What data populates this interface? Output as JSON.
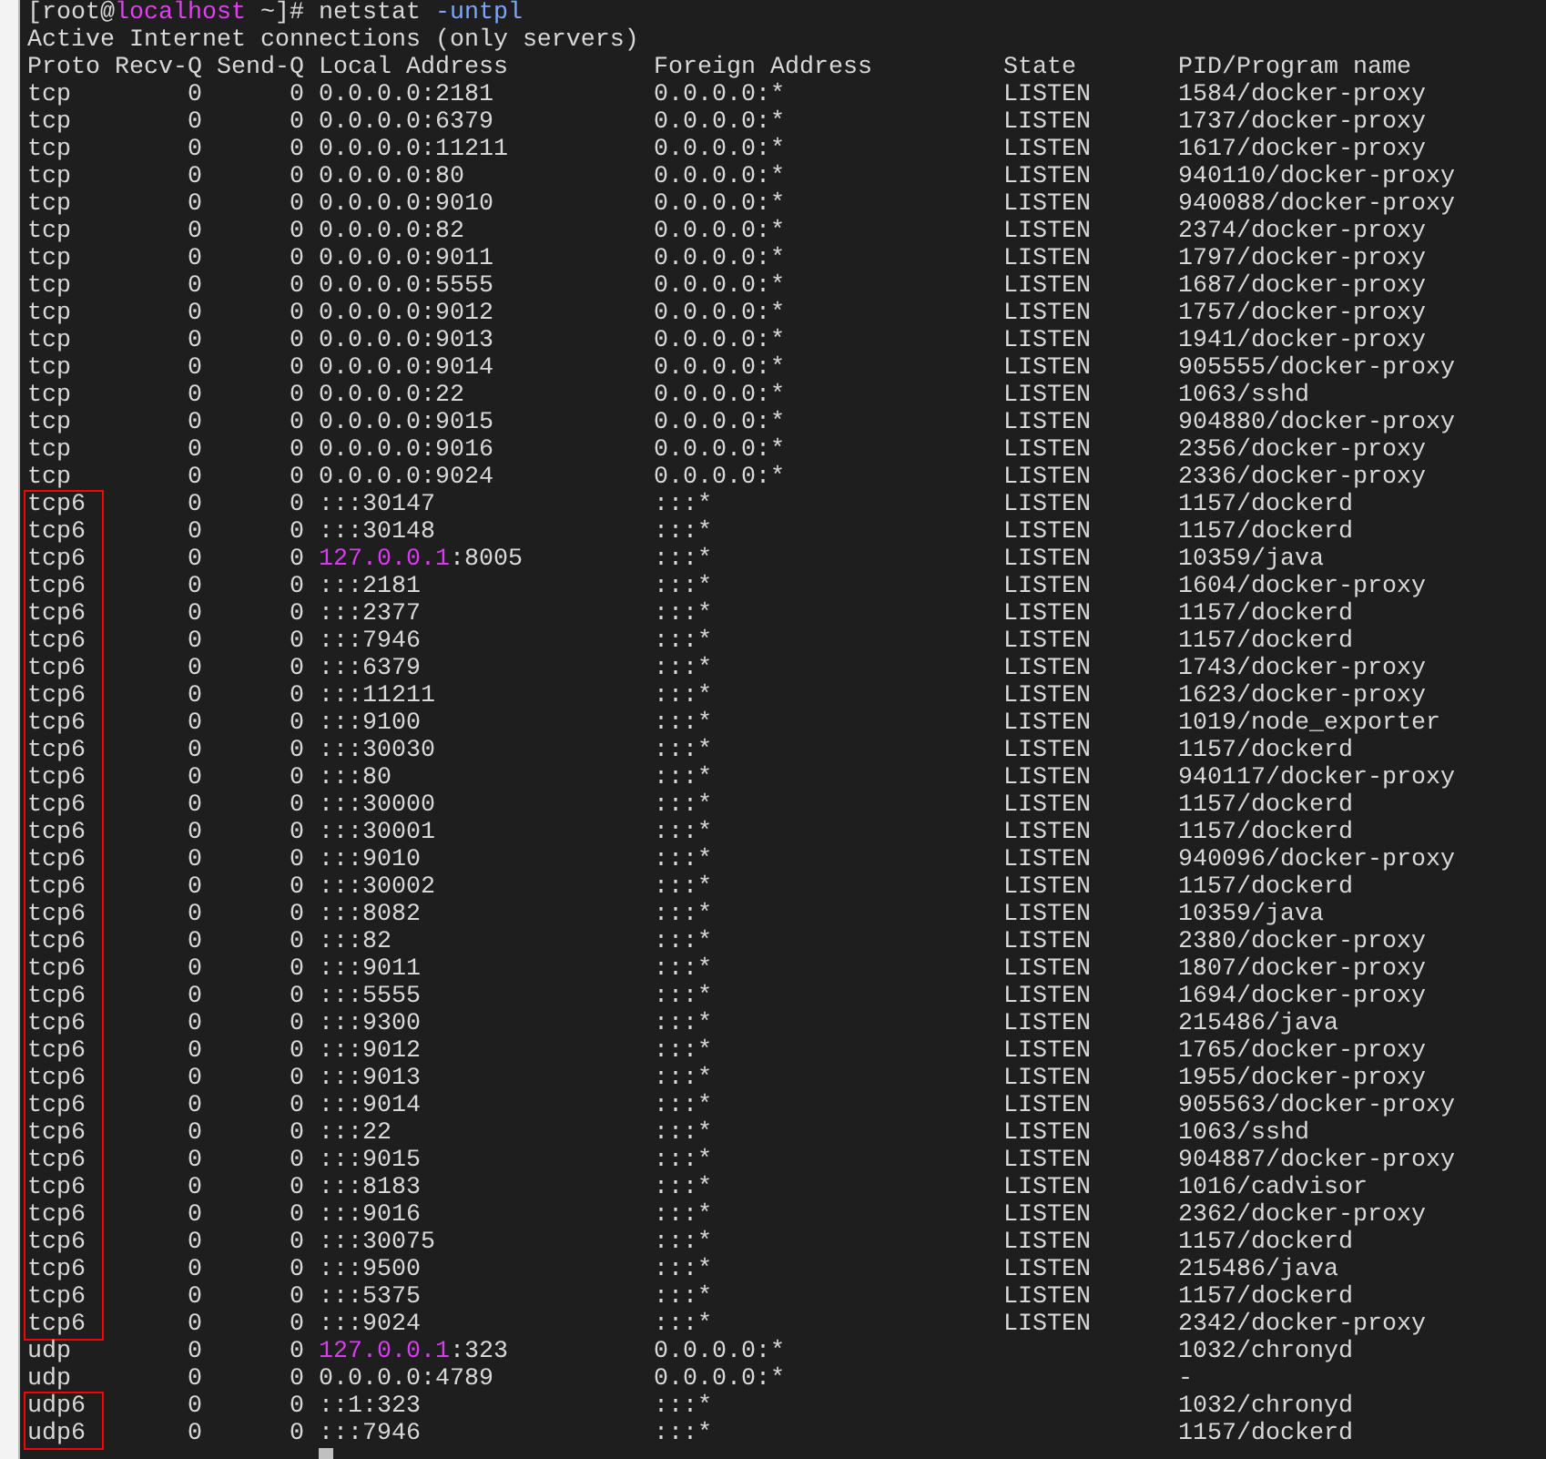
{
  "prompt": [
    {
      "text": "[root@",
      "kind": "plain"
    },
    {
      "text": "localhost",
      "kind": "host"
    },
    {
      "text": " ~]# netstat ",
      "kind": "plain"
    },
    {
      "text": "-untpl",
      "kind": "option"
    }
  ],
  "title_line": "Active Internet connections (only servers)",
  "columns": [
    "Proto",
    "Recv-Q",
    "Send-Q",
    "Local Address",
    "Foreign Address",
    "State",
    "PID/Program name"
  ],
  "rows": [
    {
      "proto": "tcp",
      "recv_q": "0",
      "send_q": "0",
      "local": "0.0.0.0:2181",
      "foreign": "0.0.0.0:*",
      "state": "LISTEN",
      "program": "1584/docker-proxy",
      "boxed": false
    },
    {
      "proto": "tcp",
      "recv_q": "0",
      "send_q": "0",
      "local": "0.0.0.0:6379",
      "foreign": "0.0.0.0:*",
      "state": "LISTEN",
      "program": "1737/docker-proxy",
      "boxed": false
    },
    {
      "proto": "tcp",
      "recv_q": "0",
      "send_q": "0",
      "local": "0.0.0.0:11211",
      "foreign": "0.0.0.0:*",
      "state": "LISTEN",
      "program": "1617/docker-proxy",
      "boxed": false
    },
    {
      "proto": "tcp",
      "recv_q": "0",
      "send_q": "0",
      "local": "0.0.0.0:80",
      "foreign": "0.0.0.0:*",
      "state": "LISTEN",
      "program": "940110/docker-proxy",
      "boxed": false
    },
    {
      "proto": "tcp",
      "recv_q": "0",
      "send_q": "0",
      "local": "0.0.0.0:9010",
      "foreign": "0.0.0.0:*",
      "state": "LISTEN",
      "program": "940088/docker-proxy",
      "boxed": false
    },
    {
      "proto": "tcp",
      "recv_q": "0",
      "send_q": "0",
      "local": "0.0.0.0:82",
      "foreign": "0.0.0.0:*",
      "state": "LISTEN",
      "program": "2374/docker-proxy",
      "boxed": false
    },
    {
      "proto": "tcp",
      "recv_q": "0",
      "send_q": "0",
      "local": "0.0.0.0:9011",
      "foreign": "0.0.0.0:*",
      "state": "LISTEN",
      "program": "1797/docker-proxy",
      "boxed": false
    },
    {
      "proto": "tcp",
      "recv_q": "0",
      "send_q": "0",
      "local": "0.0.0.0:5555",
      "foreign": "0.0.0.0:*",
      "state": "LISTEN",
      "program": "1687/docker-proxy",
      "boxed": false
    },
    {
      "proto": "tcp",
      "recv_q": "0",
      "send_q": "0",
      "local": "0.0.0.0:9012",
      "foreign": "0.0.0.0:*",
      "state": "LISTEN",
      "program": "1757/docker-proxy",
      "boxed": false
    },
    {
      "proto": "tcp",
      "recv_q": "0",
      "send_q": "0",
      "local": "0.0.0.0:9013",
      "foreign": "0.0.0.0:*",
      "state": "LISTEN",
      "program": "1941/docker-proxy",
      "boxed": false
    },
    {
      "proto": "tcp",
      "recv_q": "0",
      "send_q": "0",
      "local": "0.0.0.0:9014",
      "foreign": "0.0.0.0:*",
      "state": "LISTEN",
      "program": "905555/docker-proxy",
      "boxed": false
    },
    {
      "proto": "tcp",
      "recv_q": "0",
      "send_q": "0",
      "local": "0.0.0.0:22",
      "foreign": "0.0.0.0:*",
      "state": "LISTEN",
      "program": "1063/sshd",
      "boxed": false
    },
    {
      "proto": "tcp",
      "recv_q": "0",
      "send_q": "0",
      "local": "0.0.0.0:9015",
      "foreign": "0.0.0.0:*",
      "state": "LISTEN",
      "program": "904880/docker-proxy",
      "boxed": false
    },
    {
      "proto": "tcp",
      "recv_q": "0",
      "send_q": "0",
      "local": "0.0.0.0:9016",
      "foreign": "0.0.0.0:*",
      "state": "LISTEN",
      "program": "2356/docker-proxy",
      "boxed": false
    },
    {
      "proto": "tcp",
      "recv_q": "0",
      "send_q": "0",
      "local": "0.0.0.0:9024",
      "foreign": "0.0.0.0:*",
      "state": "LISTEN",
      "program": "2336/docker-proxy",
      "boxed": false
    },
    {
      "proto": "tcp6",
      "recv_q": "0",
      "send_q": "0",
      "local": ":::30147",
      "foreign": ":::*",
      "state": "LISTEN",
      "program": "1157/dockerd",
      "boxed": true
    },
    {
      "proto": "tcp6",
      "recv_q": "0",
      "send_q": "0",
      "local": ":::30148",
      "foreign": ":::*",
      "state": "LISTEN",
      "program": "1157/dockerd",
      "boxed": true
    },
    {
      "proto": "tcp6",
      "recv_q": "0",
      "send_q": "0",
      "local": [
        {
          "text": "127.0.0.1",
          "kind": "ip"
        },
        {
          "text": ":8005",
          "kind": "plain"
        }
      ],
      "foreign": ":::*",
      "state": "LISTEN",
      "program": "10359/java",
      "boxed": true
    },
    {
      "proto": "tcp6",
      "recv_q": "0",
      "send_q": "0",
      "local": ":::2181",
      "foreign": ":::*",
      "state": "LISTEN",
      "program": "1604/docker-proxy",
      "boxed": true
    },
    {
      "proto": "tcp6",
      "recv_q": "0",
      "send_q": "0",
      "local": ":::2377",
      "foreign": ":::*",
      "state": "LISTEN",
      "program": "1157/dockerd",
      "boxed": true
    },
    {
      "proto": "tcp6",
      "recv_q": "0",
      "send_q": "0",
      "local": ":::7946",
      "foreign": ":::*",
      "state": "LISTEN",
      "program": "1157/dockerd",
      "boxed": true
    },
    {
      "proto": "tcp6",
      "recv_q": "0",
      "send_q": "0",
      "local": ":::6379",
      "foreign": ":::*",
      "state": "LISTEN",
      "program": "1743/docker-proxy",
      "boxed": true
    },
    {
      "proto": "tcp6",
      "recv_q": "0",
      "send_q": "0",
      "local": ":::11211",
      "foreign": ":::*",
      "state": "LISTEN",
      "program": "1623/docker-proxy",
      "boxed": true
    },
    {
      "proto": "tcp6",
      "recv_q": "0",
      "send_q": "0",
      "local": ":::9100",
      "foreign": ":::*",
      "state": "LISTEN",
      "program": "1019/node_exporter",
      "boxed": true
    },
    {
      "proto": "tcp6",
      "recv_q": "0",
      "send_q": "0",
      "local": ":::30030",
      "foreign": ":::*",
      "state": "LISTEN",
      "program": "1157/dockerd",
      "boxed": true
    },
    {
      "proto": "tcp6",
      "recv_q": "0",
      "send_q": "0",
      "local": ":::80",
      "foreign": ":::*",
      "state": "LISTEN",
      "program": "940117/docker-proxy",
      "boxed": true
    },
    {
      "proto": "tcp6",
      "recv_q": "0",
      "send_q": "0",
      "local": ":::30000",
      "foreign": ":::*",
      "state": "LISTEN",
      "program": "1157/dockerd",
      "boxed": true
    },
    {
      "proto": "tcp6",
      "recv_q": "0",
      "send_q": "0",
      "local": ":::30001",
      "foreign": ":::*",
      "state": "LISTEN",
      "program": "1157/dockerd",
      "boxed": true
    },
    {
      "proto": "tcp6",
      "recv_q": "0",
      "send_q": "0",
      "local": ":::9010",
      "foreign": ":::*",
      "state": "LISTEN",
      "program": "940096/docker-proxy",
      "boxed": true
    },
    {
      "proto": "tcp6",
      "recv_q": "0",
      "send_q": "0",
      "local": ":::30002",
      "foreign": ":::*",
      "state": "LISTEN",
      "program": "1157/dockerd",
      "boxed": true
    },
    {
      "proto": "tcp6",
      "recv_q": "0",
      "send_q": "0",
      "local": ":::8082",
      "foreign": ":::*",
      "state": "LISTEN",
      "program": "10359/java",
      "boxed": true
    },
    {
      "proto": "tcp6",
      "recv_q": "0",
      "send_q": "0",
      "local": ":::82",
      "foreign": ":::*",
      "state": "LISTEN",
      "program": "2380/docker-proxy",
      "boxed": true
    },
    {
      "proto": "tcp6",
      "recv_q": "0",
      "send_q": "0",
      "local": ":::9011",
      "foreign": ":::*",
      "state": "LISTEN",
      "program": "1807/docker-proxy",
      "boxed": true
    },
    {
      "proto": "tcp6",
      "recv_q": "0",
      "send_q": "0",
      "local": ":::5555",
      "foreign": ":::*",
      "state": "LISTEN",
      "program": "1694/docker-proxy",
      "boxed": true
    },
    {
      "proto": "tcp6",
      "recv_q": "0",
      "send_q": "0",
      "local": ":::9300",
      "foreign": ":::*",
      "state": "LISTEN",
      "program": "215486/java",
      "boxed": true
    },
    {
      "proto": "tcp6",
      "recv_q": "0",
      "send_q": "0",
      "local": ":::9012",
      "foreign": ":::*",
      "state": "LISTEN",
      "program": "1765/docker-proxy",
      "boxed": true
    },
    {
      "proto": "tcp6",
      "recv_q": "0",
      "send_q": "0",
      "local": ":::9013",
      "foreign": ":::*",
      "state": "LISTEN",
      "program": "1955/docker-proxy",
      "boxed": true
    },
    {
      "proto": "tcp6",
      "recv_q": "0",
      "send_q": "0",
      "local": ":::9014",
      "foreign": ":::*",
      "state": "LISTEN",
      "program": "905563/docker-proxy",
      "boxed": true
    },
    {
      "proto": "tcp6",
      "recv_q": "0",
      "send_q": "0",
      "local": ":::22",
      "foreign": ":::*",
      "state": "LISTEN",
      "program": "1063/sshd",
      "boxed": true
    },
    {
      "proto": "tcp6",
      "recv_q": "0",
      "send_q": "0",
      "local": ":::9015",
      "foreign": ":::*",
      "state": "LISTEN",
      "program": "904887/docker-proxy",
      "boxed": true
    },
    {
      "proto": "tcp6",
      "recv_q": "0",
      "send_q": "0",
      "local": ":::8183",
      "foreign": ":::*",
      "state": "LISTEN",
      "program": "1016/cadvisor",
      "boxed": true
    },
    {
      "proto": "tcp6",
      "recv_q": "0",
      "send_q": "0",
      "local": ":::9016",
      "foreign": ":::*",
      "state": "LISTEN",
      "program": "2362/docker-proxy",
      "boxed": true
    },
    {
      "proto": "tcp6",
      "recv_q": "0",
      "send_q": "0",
      "local": ":::30075",
      "foreign": ":::*",
      "state": "LISTEN",
      "program": "1157/dockerd",
      "boxed": true
    },
    {
      "proto": "tcp6",
      "recv_q": "0",
      "send_q": "0",
      "local": ":::9500",
      "foreign": ":::*",
      "state": "LISTEN",
      "program": "215486/java",
      "boxed": true
    },
    {
      "proto": "tcp6",
      "recv_q": "0",
      "send_q": "0",
      "local": ":::5375",
      "foreign": ":::*",
      "state": "LISTEN",
      "program": "1157/dockerd",
      "boxed": true
    },
    {
      "proto": "tcp6",
      "recv_q": "0",
      "send_q": "0",
      "local": ":::9024",
      "foreign": ":::*",
      "state": "LISTEN",
      "program": "2342/docker-proxy",
      "boxed": true
    },
    {
      "proto": "udp",
      "recv_q": "0",
      "send_q": "0",
      "local": [
        {
          "text": "127.0.0.1",
          "kind": "ip"
        },
        {
          "text": ":323",
          "kind": "plain"
        }
      ],
      "foreign": "0.0.0.0:*",
      "program": "1032/chronyd",
      "boxed": false
    },
    {
      "proto": "udp",
      "recv_q": "0",
      "send_q": "0",
      "local": "0.0.0.0:4789",
      "foreign": "0.0.0.0:*",
      "program": "-",
      "boxed": false
    },
    {
      "proto": "udp6",
      "recv_q": "0",
      "send_q": "0",
      "local": "::1:323",
      "foreign": ":::*",
      "program": "1032/chronyd",
      "boxed": true
    },
    {
      "proto": "udp6",
      "recv_q": "0",
      "send_q": "0",
      "local": ":::7946",
      "foreign": ":::*",
      "program": "1157/dockerd",
      "boxed": true
    }
  ]
}
